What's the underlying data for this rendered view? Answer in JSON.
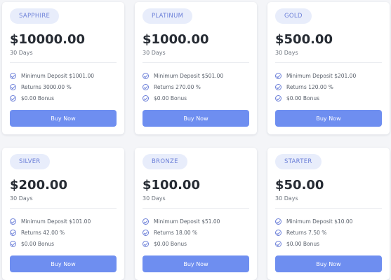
{
  "plans": [
    {
      "name": "SAPPHIRE",
      "price": "$10000.00",
      "duration": "30 Days",
      "features": [
        "Minimum Deposit $1001.00",
        "Returns 3000.00 %",
        "$0.00 Bonus"
      ],
      "button": "Buy Now"
    },
    {
      "name": "PLATINUM",
      "price": "$1000.00",
      "duration": "30 Days",
      "features": [
        "Minimum Deposit $501.00",
        "Returns 270.00 %",
        "$0.00 Bonus"
      ],
      "button": "Buy Now"
    },
    {
      "name": "GOLD",
      "price": "$500.00",
      "duration": "30 Days",
      "features": [
        "Minimum Deposit $201.00",
        "Returns 120.00 %",
        "$0.00 Bonus"
      ],
      "button": "Buy Now"
    },
    {
      "name": "SILVER",
      "price": "$200.00",
      "duration": "30 Days",
      "features": [
        "Minimum Deposit $101.00",
        "Returns 42.00 %",
        "$0.00 Bonus"
      ],
      "button": "Buy Now"
    },
    {
      "name": "BRONZE",
      "price": "$100.00",
      "duration": "30 Days",
      "features": [
        "Minimum Deposit $51.00",
        "Returns 18.00 %",
        "$0.00 Bonus"
      ],
      "button": "Buy Now"
    },
    {
      "name": "STARTER",
      "price": "$50.00",
      "duration": "30 Days",
      "features": [
        "Minimum Deposit $10.00",
        "Returns 7.50 %",
        "$0.00 Bonus"
      ],
      "button": "Buy Now"
    }
  ],
  "icons": {
    "feature_icon": "check-circle-icon"
  },
  "colors": {
    "accent": "#6e8ef0",
    "badge_bg": "#e8edfb",
    "badge_text": "#6b7fd8",
    "page_bg": "#f4f5f8",
    "card_bg": "#ffffff"
  }
}
